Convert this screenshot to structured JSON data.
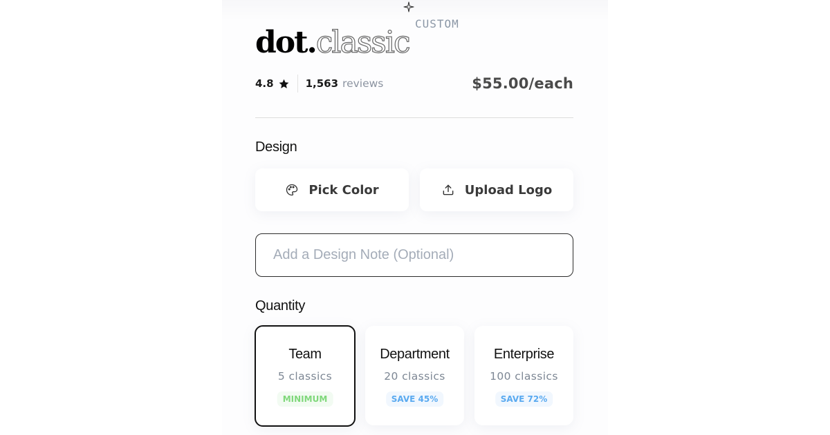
{
  "product": {
    "brand_bold": "dot.",
    "brand_outline": "classic",
    "brand_icon": "sparkle-icon",
    "tag": "CUSTOM",
    "rating": "4.8",
    "rating_icon": "star-icon",
    "review_count": "1,563",
    "review_label": "reviews",
    "price": "$55.00/each"
  },
  "design": {
    "label": "Design",
    "buttons": [
      {
        "label": "Pick Color",
        "icon": "palette-icon"
      },
      {
        "label": "Upload Logo",
        "icon": "upload-icon"
      }
    ],
    "note": {
      "value": "",
      "placeholder": "Add a Design Note (Optional)"
    }
  },
  "quantity": {
    "label": "Quantity",
    "selected": "Team",
    "tiers": [
      {
        "name": "Team",
        "count": "5 classics",
        "badge": "MINIMUM",
        "badge_color": "#7fd87a"
      },
      {
        "name": "Department",
        "count": "20 classics",
        "badge": "SAVE 45%",
        "badge_color": "#5aaaf0"
      },
      {
        "name": "Enterprise",
        "count": "100 classics",
        "badge": "SAVE 72%",
        "badge_color": "#5aaaf0"
      }
    ]
  }
}
